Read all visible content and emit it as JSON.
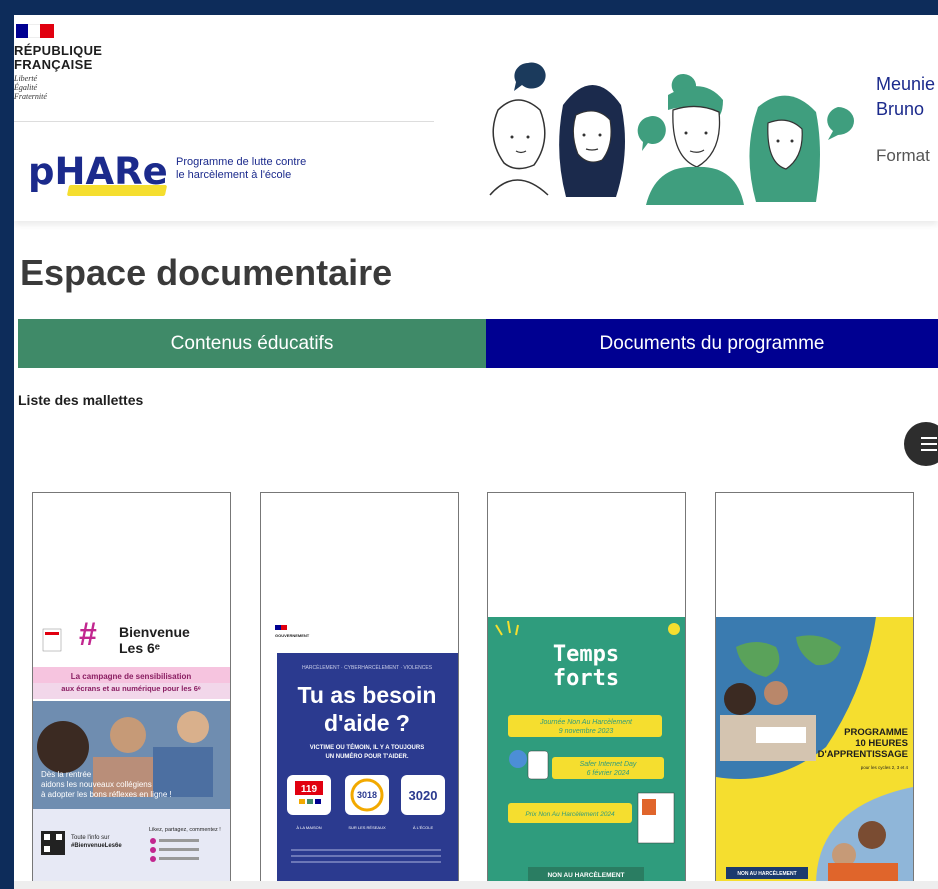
{
  "header": {
    "gov_name_line1": "RÉPUBLIQUE",
    "gov_name_line2": "FRANÇAISE",
    "devise_1": "Liberté",
    "devise_2": "Égalité",
    "devise_3": "Fraternité",
    "brand": "pHARe",
    "brand_tagline_1": "Programme de lutte contre",
    "brand_tagline_2": "le harcèlement à l'école",
    "user_line1": "Meunie",
    "user_line2": "Bruno",
    "user_role": "Format"
  },
  "page_title": "Espace documentaire",
  "tabs": [
    {
      "label": "Contenus éducatifs",
      "active": true,
      "color": "#3f8a68"
    },
    {
      "label": "Documents du programme",
      "active": false,
      "color": "#000091"
    }
  ],
  "list_label": "Liste des mallettes",
  "menu_icon": "hamburger-menu-icon",
  "cards": [
    {
      "heading_1": "Bienvenue",
      "heading_2": "Les 6ᵉ",
      "banner_1": "La campagne de sensibilisation",
      "banner_2": "aux écrans et au numérique pour les 6ᵉ",
      "overlay_1": "Dès la rentrée",
      "overlay_2": "aidons les nouveaux collégiens",
      "overlay_3": "à adopter les bons réflexes en ligne !",
      "footer_1": "Toute l'info sur",
      "footer_2": "#BienvenueLes6e",
      "footer_3": "Likez, partagez, commentez !"
    },
    {
      "gov": "GOUVERNEMENT",
      "kicker": "HARCÈLEMENT · CYBERHARCÈLEMENT · VIOLENCES",
      "headline_1": "Tu as besoin",
      "headline_2": "d'aide ?",
      "sub_1": "VICTIME OU TÉMOIN, IL Y A TOUJOURS",
      "sub_2": "UN NUMÉRO POUR T'AIDER.",
      "numbers": [
        "119",
        "3018",
        "3020"
      ],
      "number_labels": [
        "À LA MAISON",
        "SUR LES RÉSEAUX",
        "À L'ÉCOLE"
      ]
    },
    {
      "title_1": "Temps",
      "title_2": "forts",
      "event_1a": "Journée Non Au Harcèlement",
      "event_1b": "9 novembre 2023",
      "event_2a": "Safer Internet Day",
      "event_2b": "6 février 2024",
      "event_3": "Prix Non Au Harcèlement 2024",
      "footer": "NON AU HARCÈLEMENT"
    },
    {
      "title_1": "PROGRAMME",
      "title_2": "10 HEURES",
      "title_3": "D'APPRENTISSAGE",
      "sub": "pour les cycles 2, 3 et 4",
      "footer": "NON AU HARCÈLEMENT"
    }
  ]
}
